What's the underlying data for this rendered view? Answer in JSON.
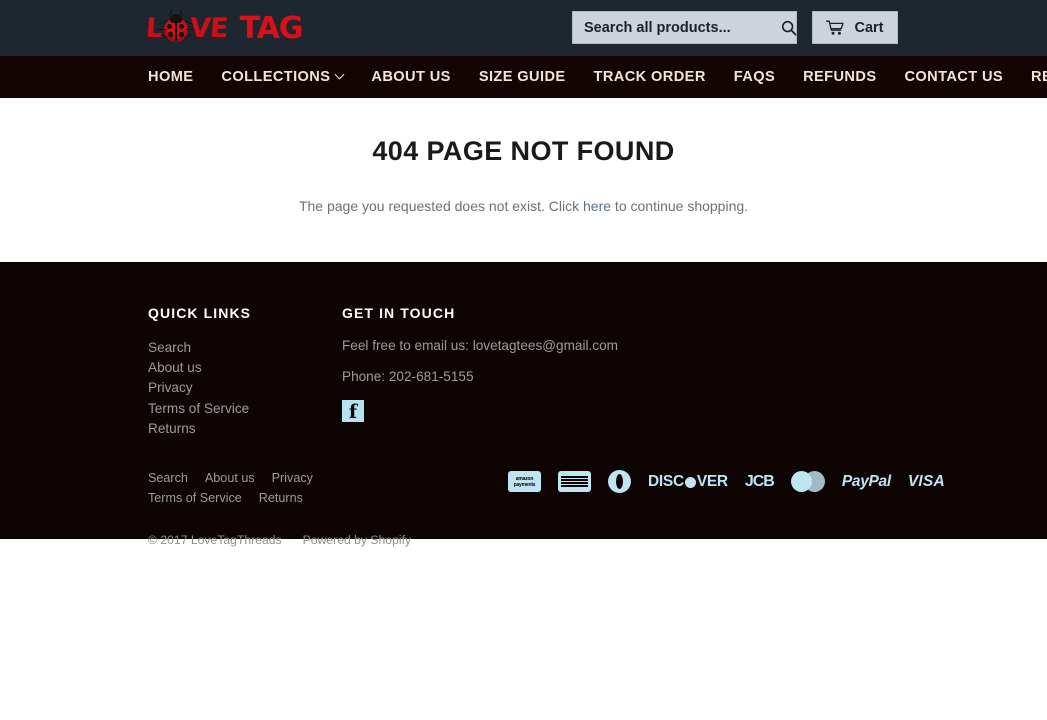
{
  "header": {
    "logo": {
      "letters_before": [
        "L"
      ],
      "ladybug_icon": "ladybug-icon",
      "letters_after": [
        "V",
        "E"
      ],
      "tag_text": "TAG",
      "alt": "LoveTag",
      "brand_color": "#cc1016"
    },
    "search": {
      "placeholder": "Search all products...",
      "value": "",
      "icon": "search-icon"
    },
    "cart": {
      "label": "Cart",
      "icon": "shopping-cart-icon"
    },
    "background_color": "#1e2630"
  },
  "nav": {
    "background_color": "#140505",
    "text_color": "#f3e5d4",
    "items": [
      {
        "label": "HOME",
        "has_dropdown": false
      },
      {
        "label": "COLLECTIONS",
        "has_dropdown": true
      },
      {
        "label": "ABOUT US",
        "has_dropdown": false
      },
      {
        "label": "SIZE GUIDE",
        "has_dropdown": false
      },
      {
        "label": "TRACK ORDER",
        "has_dropdown": false
      },
      {
        "label": "FAQS",
        "has_dropdown": false
      },
      {
        "label": "REFUNDS",
        "has_dropdown": false
      },
      {
        "label": "CONTACT US",
        "has_dropdown": false
      },
      {
        "label": "REVIEWS",
        "has_dropdown": false
      }
    ]
  },
  "main": {
    "title": "404 PAGE NOT FOUND",
    "message_before": "The page you requested does not exist. Click ",
    "link_text": "here",
    "message_after": " to continue shopping."
  },
  "footer": {
    "background_color": "#0d0403",
    "quick_links": {
      "heading": "QUICK LINKS",
      "items": [
        {
          "label": "Search"
        },
        {
          "label": "About us"
        },
        {
          "label": "Privacy"
        },
        {
          "label": "Terms of Service"
        },
        {
          "label": "Returns"
        }
      ]
    },
    "get_in_touch": {
      "heading": "GET IN TOUCH",
      "email_line": "Feel free to email us: lovetagtees@gmail.com",
      "phone_line": "Phone: 202-681-5155",
      "social": [
        {
          "name": "facebook-icon",
          "glyph": "f",
          "color": "#b5e2f0"
        }
      ]
    },
    "bottom_links": [
      {
        "label": "Search"
      },
      {
        "label": "About us"
      },
      {
        "label": "Privacy"
      },
      {
        "label": "Terms of Service"
      },
      {
        "label": "Returns"
      }
    ],
    "copyright": "© 2017 LoveTagThreads",
    "powered_by": "Powered by Shopify",
    "payment_icons": [
      {
        "name": "amazon-payments-icon",
        "line1": "amazon",
        "line2": "payments"
      },
      {
        "name": "american-express-icon",
        "label": "AMERICAN EXPRESS"
      },
      {
        "name": "diners-club-icon",
        "label": "Diners Club"
      },
      {
        "name": "discover-icon",
        "label": "DISCOVER"
      },
      {
        "name": "jcb-icon",
        "label": "JCB"
      },
      {
        "name": "mastercard-icon",
        "label": "MasterCard"
      },
      {
        "name": "paypal-icon",
        "label": "PayPal"
      },
      {
        "name": "visa-icon",
        "label": "VISA"
      }
    ],
    "payment_icon_color": "#bfe5f2"
  }
}
